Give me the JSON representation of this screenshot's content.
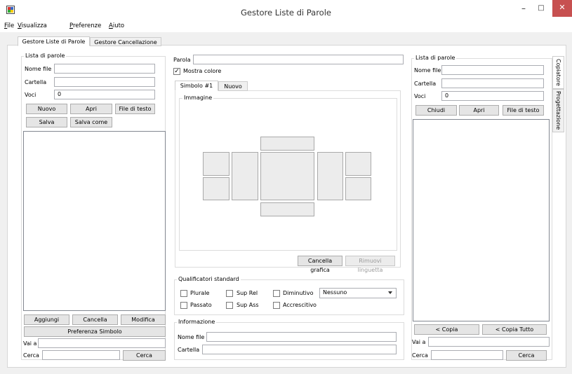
{
  "window": {
    "title": "Gestore Liste di Parole",
    "minimize_glyph": "–",
    "maximize_glyph": "□",
    "close_glyph": "✕"
  },
  "menu": [
    {
      "label": "File",
      "u": "F",
      "rest": "ile"
    },
    {
      "label": "Visualizza",
      "u": "V",
      "rest": "isualizza"
    },
    {
      "label": "Preferenze",
      "u": "P",
      "rest": "referenze"
    },
    {
      "label": "Aiuto",
      "u": "A",
      "rest": "iuto"
    }
  ],
  "tabs": {
    "main": "Gestore Liste di Parole",
    "delete": "Gestore Cancellazione"
  },
  "left": {
    "group": "Lista di parole",
    "nome_file_label": "Nome file",
    "nome_file": "",
    "cartella_label": "Cartella",
    "cartella": "",
    "voci_label": "Voci",
    "voci": "0",
    "nuovo": "Nuovo",
    "apri": "Apri",
    "file_di_testo": "File di testo",
    "salva": "Salva",
    "salva_come": "Salva come",
    "aggiungi": "Aggiungi",
    "cancella": "Cancella",
    "modifica": "Modifica",
    "preferenza_simbolo": "Preferenza Simbolo",
    "vai_a_label": "Vai a",
    "vai_a": "",
    "cerca_label": "Cerca",
    "cerca": "",
    "cerca_button": "Cerca"
  },
  "center": {
    "parola_label": "Parola",
    "parola": "",
    "mostra_colore": "Mostra colore",
    "mostra_colore_checked": true,
    "tab_simbolo": "Simbolo #1",
    "tab_nuovo": "Nuovo",
    "immagine": "Immagine",
    "cancella_grafica": "Cancella grafica",
    "rimuovi_linguetta": "Rimuovi linguetta",
    "qualificatori": "Qualificatori standard",
    "checks": {
      "plurale": "Plurale",
      "sup_rel": "Sup Rel",
      "diminutivo": "Diminutivo",
      "passato": "Passato",
      "sup_ass": "Sup Ass",
      "accrescitivo": "Accrescitivo"
    },
    "dropdown": "Nessuno",
    "informazione": "Informazione",
    "nome_file_label": "Nome file",
    "nome_file": "",
    "cartella_label": "Cartella",
    "cartella": ""
  },
  "right": {
    "group": "Lista di parole",
    "nome_file_label": "Nome file",
    "nome_file": "",
    "cartella_label": "Cartella",
    "cartella": "",
    "voci_label": "Voci",
    "voci": "0",
    "chiudi": "Chiudi",
    "apri": "Apri",
    "file_di_testo": "File di testo",
    "copia": "< Copia",
    "copia_tutto": "< Copia Tutto",
    "vai_a_label": "Vai a",
    "vai_a": "",
    "cerca_label": "Cerca",
    "cerca": "",
    "cerca_button": "Cerca"
  },
  "side_tabs": {
    "copiatore": "Copiatore",
    "progettazione": "Progettazione"
  },
  "colors": {
    "close_bg": "#c75050",
    "accent_border": "#abadb3"
  }
}
